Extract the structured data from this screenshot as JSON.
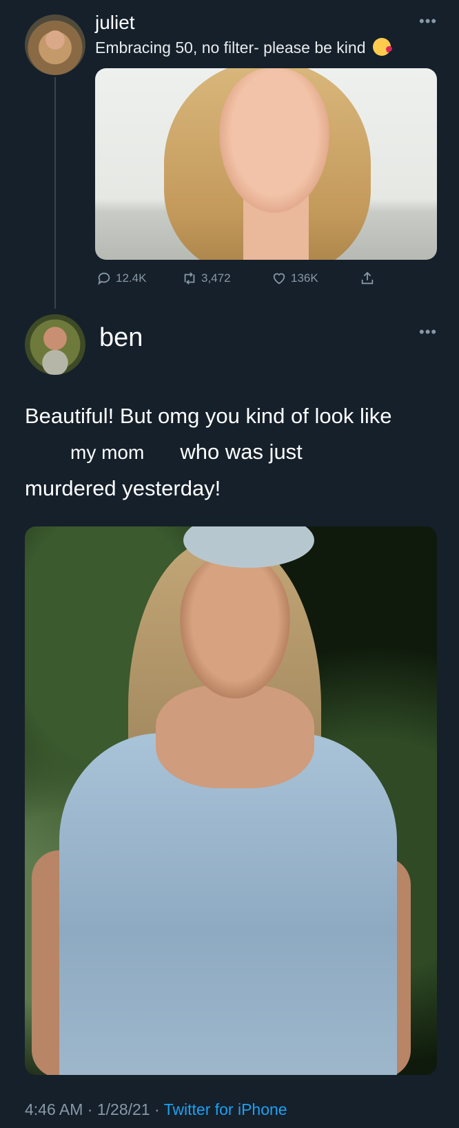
{
  "juliet": {
    "name": "juliet",
    "text": "Embracing 50, no filter- please be kind",
    "emoji": "face-blowing-a-kiss",
    "replies": "12.4K",
    "retweets": "3,472",
    "likes": "136K"
  },
  "ben": {
    "name": "ben",
    "text_line1": "Beautiful! But omg you kind of look like",
    "text_mymom": "my mom",
    "text_line2": "who was just",
    "text_line3": "murdered yesterday!"
  },
  "footer": {
    "time": "4:46 AM",
    "separator1": " · ",
    "date": "1/28/21",
    "separator2": " · ",
    "source": "Twitter for iPhone"
  },
  "colors": {
    "background": "#15202b",
    "secondary_text": "#8899a6",
    "link": "#1da1f2"
  },
  "icons": [
    "more-icon",
    "reply-icon",
    "retweet-icon",
    "like-icon",
    "share-icon"
  ]
}
